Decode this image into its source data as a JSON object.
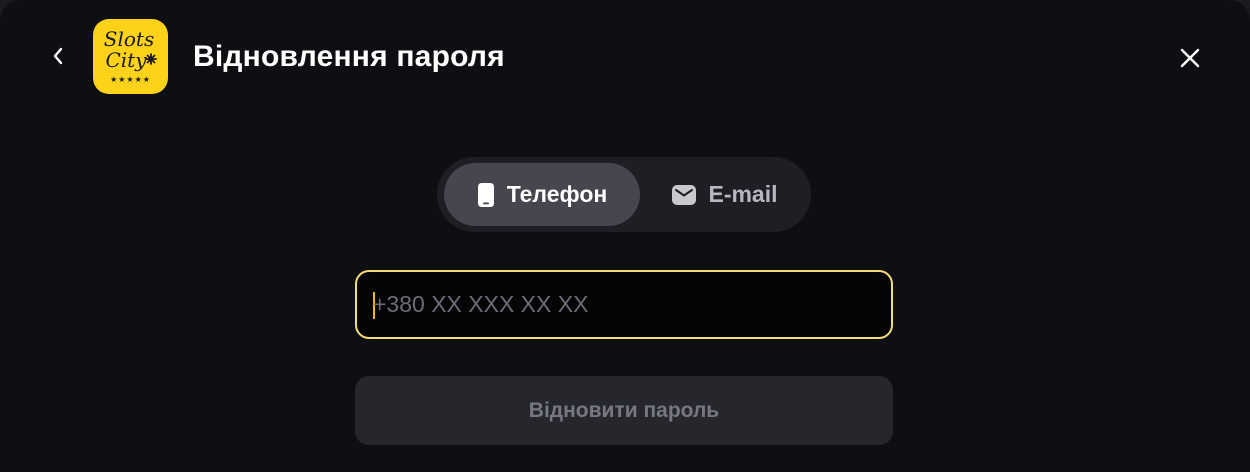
{
  "header": {
    "title": "Відновлення пароля",
    "back_icon": "chevron-left-icon",
    "close_icon": "close-icon",
    "logo": {
      "line1": "Slots",
      "line2": "City",
      "stars": "★★★★★",
      "background": "#ffd21a"
    }
  },
  "tabs": [
    {
      "label": "Телефон",
      "icon": "smartphone-icon",
      "active": true
    },
    {
      "label": "E-mail",
      "icon": "mail-icon",
      "active": false
    }
  ],
  "phone_field": {
    "placeholder": "+380 XX XXX XX XX",
    "value": "",
    "border_color": "#f4db77"
  },
  "submit": {
    "label": "Відновити пароль",
    "enabled": false
  },
  "colors": {
    "background": "#0e0f13",
    "accent": "#f4db77",
    "active_tab": "#45464e",
    "tab_container": "#1e1f25",
    "disabled_button": "#26272d"
  }
}
